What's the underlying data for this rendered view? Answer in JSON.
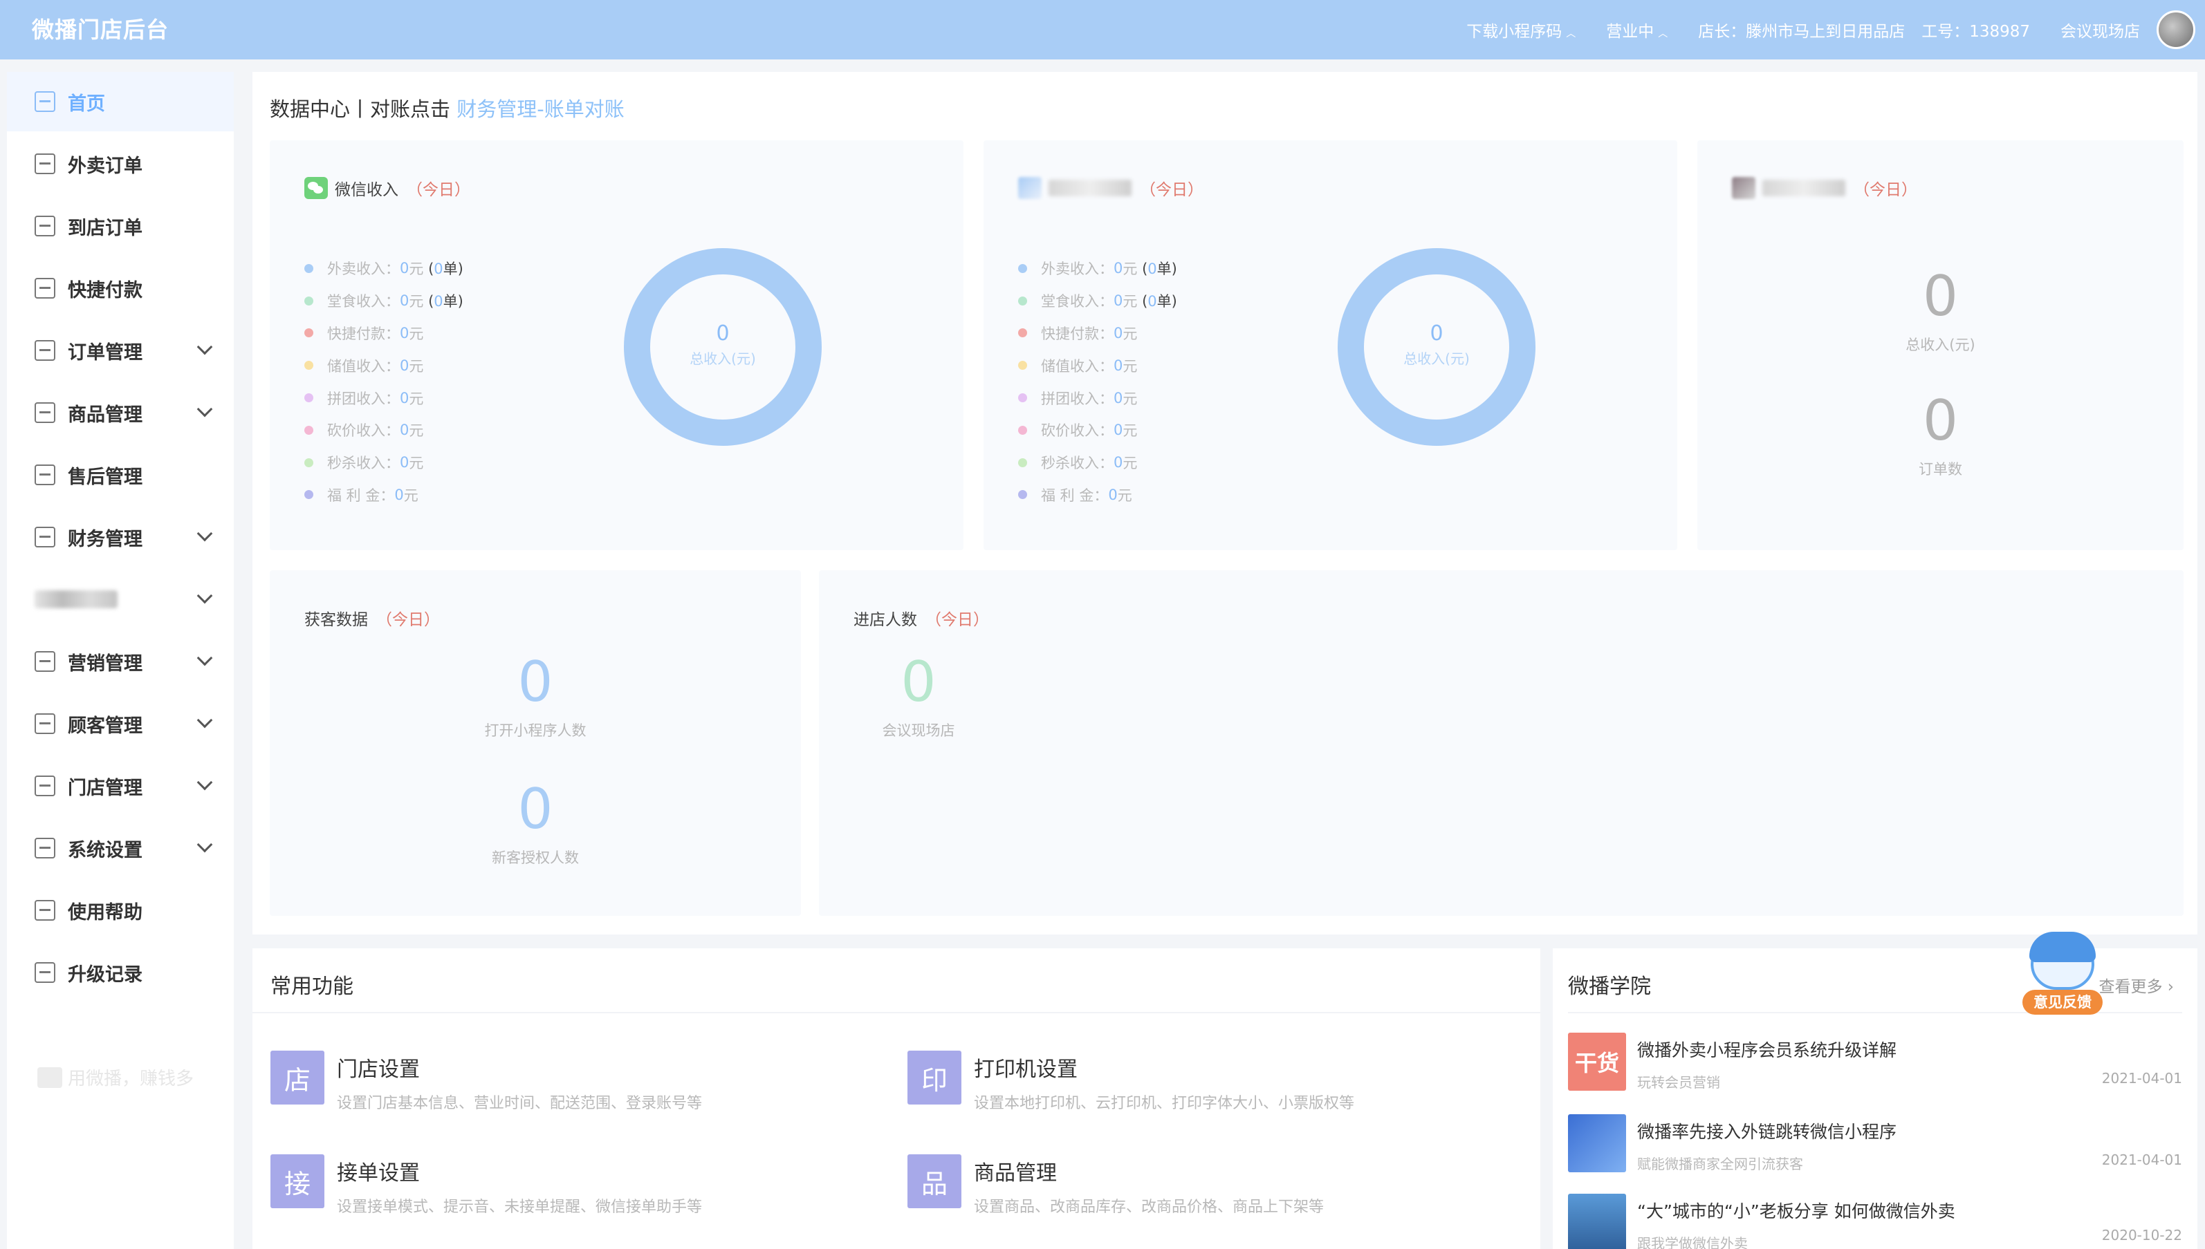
{
  "header": {
    "brand": "微播门店后台",
    "download_mini": "下载小程序码",
    "status": "营业中",
    "store_label": "店长：滕州市马上到日用品店",
    "staff_id": "工号：138987",
    "venue": "会议现场店",
    "bg_color": "#a9cdf6"
  },
  "sidebar": {
    "items": [
      {
        "label": "首页",
        "icon": "monitor-icon",
        "active": true
      },
      {
        "label": "外卖订单",
        "icon": "clipboard-check-icon"
      },
      {
        "label": "到店订单",
        "icon": "people-icon"
      },
      {
        "label": "快捷付款",
        "icon": "pay-icon"
      },
      {
        "label": "订单管理",
        "icon": "order-icon",
        "expand": true
      },
      {
        "label": "商品管理",
        "icon": "bag-icon",
        "expand": true
      },
      {
        "label": "售后管理",
        "icon": "headset-icon"
      },
      {
        "label": "财务管理",
        "icon": "finance-icon",
        "expand": true
      },
      {
        "label": "",
        "icon": "blurred-icon",
        "expand": true
      },
      {
        "label": "营销管理",
        "icon": "marketing-icon",
        "expand": true
      },
      {
        "label": "顾客管理",
        "icon": "customer-icon",
        "expand": true
      },
      {
        "label": "门店管理",
        "icon": "store-icon",
        "expand": true
      },
      {
        "label": "系统设置",
        "icon": "settings-icon",
        "expand": true
      },
      {
        "label": "使用帮助",
        "icon": "help-icon"
      },
      {
        "label": "升级记录",
        "icon": "upgrade-icon"
      }
    ],
    "footer": "用微播，赚钱多"
  },
  "main": {
    "title_prefix": "数据中心丨对账点击",
    "title_link": "财务管理-账单对账",
    "today": "（今日）",
    "wechat_card": {
      "title": "微信收入",
      "legend": [
        {
          "label": "外卖收入：",
          "value": "0",
          "unit": "元",
          "orders": "0",
          "color": "#a9cdf6"
        },
        {
          "label": "堂食收入：",
          "value": "0",
          "unit": "元",
          "orders": "0",
          "color": "#b7e7cd"
        },
        {
          "label": "快捷付款：",
          "value": "0",
          "unit": "元",
          "color": "#f3a9a7"
        },
        {
          "label": "储值收入：",
          "value": "0",
          "unit": "元",
          "color": "#f9e1a2"
        },
        {
          "label": "拼团收入：",
          "value": "0",
          "unit": "元",
          "color": "#e5c1f3"
        },
        {
          "label": "砍价收入：",
          "value": "0",
          "unit": "元",
          "color": "#f4b7d3"
        },
        {
          "label": "秒杀收入：",
          "value": "0",
          "unit": "元",
          "color": "#c9ecc0"
        },
        {
          "label": "福 利 金：",
          "value": "0",
          "unit": "元",
          "color": "#b5b8ef"
        }
      ],
      "donut_value": "0",
      "donut_label": "总收入(元)"
    },
    "second_card": {
      "legend": [
        {
          "label": "外卖收入：",
          "value": "0",
          "unit": "元",
          "orders": "0",
          "color": "#a9cdf6"
        },
        {
          "label": "堂食收入：",
          "value": "0",
          "unit": "元",
          "orders": "0",
          "color": "#b7e7cd"
        },
        {
          "label": "快捷付款：",
          "value": "0",
          "unit": "元",
          "color": "#f3a9a7"
        },
        {
          "label": "储值收入：",
          "value": "0",
          "unit": "元",
          "color": "#f9e1a2"
        },
        {
          "label": "拼团收入：",
          "value": "0",
          "unit": "元",
          "color": "#e5c1f3"
        },
        {
          "label": "砍价收入：",
          "value": "0",
          "unit": "元",
          "color": "#f4b7d3"
        },
        {
          "label": "秒杀收入：",
          "value": "0",
          "unit": "元",
          "color": "#c9ecc0"
        },
        {
          "label": "福 利 金：",
          "value": "0",
          "unit": "元",
          "color": "#b5b8ef"
        }
      ],
      "donut_value": "0",
      "donut_label": "总收入(元)"
    },
    "third_card": {
      "total_value": "0",
      "total_label": "总收入(元)",
      "orders_value": "0",
      "orders_label": "订单数"
    },
    "acquire_card": {
      "title": "获客数据",
      "open_value": "0",
      "open_label": "打开小程序人数",
      "new_value": "0",
      "new_label": "新客授权人数"
    },
    "visitors_card": {
      "title": "进店人数",
      "value": "0",
      "label": "会议现场店"
    }
  },
  "functions": {
    "title": "常用功能",
    "items": [
      {
        "badge": "店",
        "title": "门店设置",
        "desc": "设置门店基本信息、营业时间、配送范围、登录账号等"
      },
      {
        "badge": "印",
        "title": "打印机设置",
        "desc": "设置本地打印机、云打印机、打印字体大小、小票版权等"
      },
      {
        "badge": "接",
        "title": "接单设置",
        "desc": "设置接单模式、提示音、未接单提醒、微信接单助手等"
      },
      {
        "badge": "品",
        "title": "商品管理",
        "desc": "设置商品、改商品库存、改商品价格、商品上下架等"
      }
    ]
  },
  "academy": {
    "title": "微播学院",
    "more": "查看更多 ›",
    "feedback": "意见反馈",
    "articles": [
      {
        "title": "微播外卖小程序会员系统升级详解",
        "sub": "玩转会员营销",
        "date": "2021-04-01",
        "thumb_text": "干货"
      },
      {
        "title": "微播率先接入外链跳转微信小程序",
        "sub": "赋能微播商家全网引流获客",
        "date": "2021-04-01"
      },
      {
        "title": "“大”城市的“小”老板分享 如何做微信外卖",
        "sub": "跟我学做微信外卖",
        "date": "2020-10-22"
      }
    ]
  }
}
